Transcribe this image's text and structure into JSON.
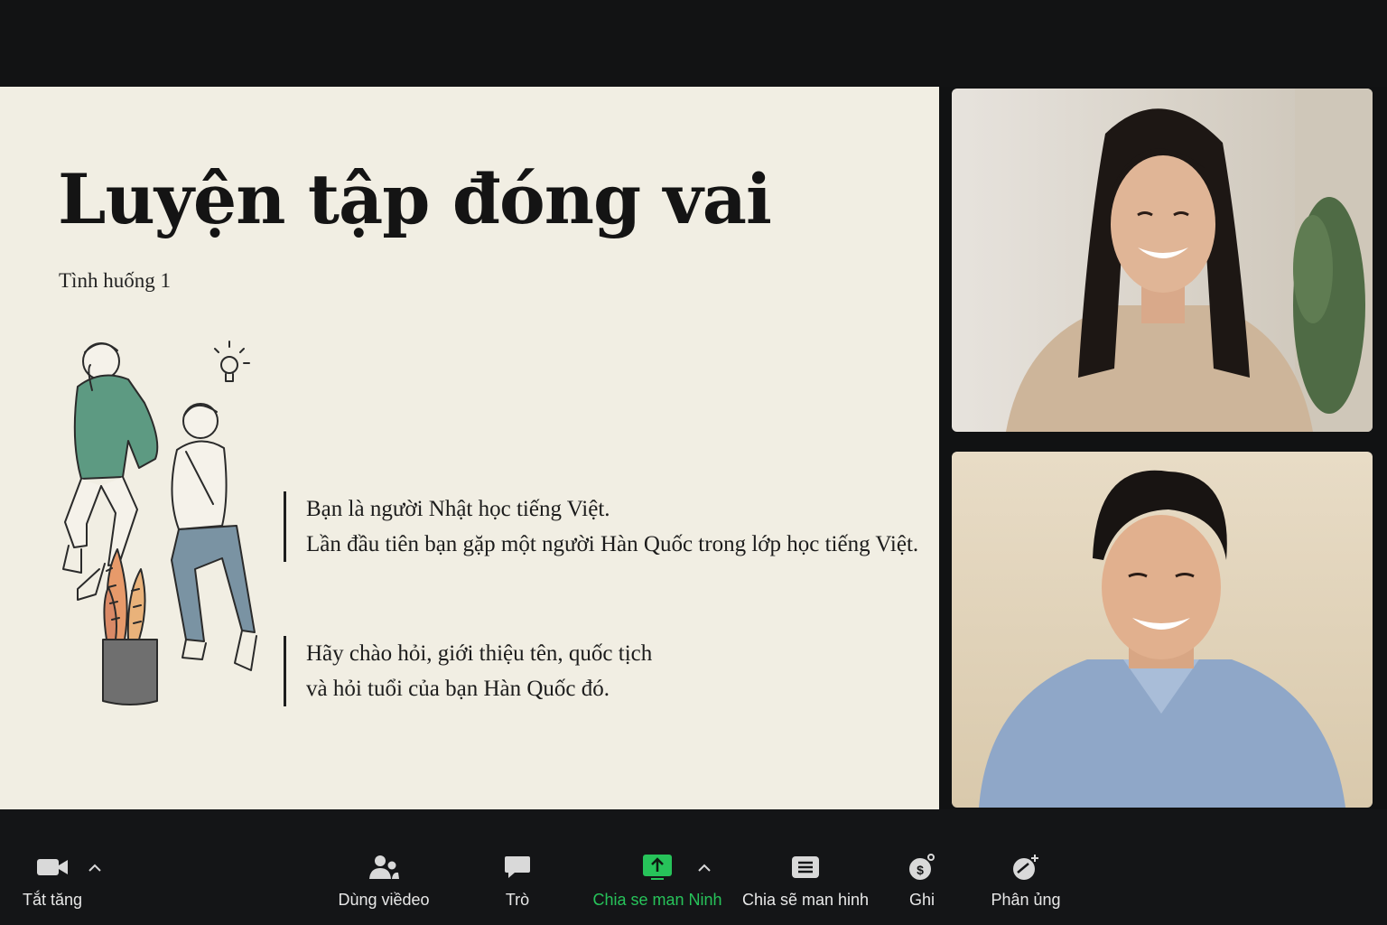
{
  "slide": {
    "title": "Luyện tập đóng vai",
    "subtitle": "Tình huống 1",
    "block1": [
      "Bạn là người Nhật học tiếng Việt.",
      "Lần đầu tiên bạn gặp một người Hàn Quốc trong lớp học tiếng Việt."
    ],
    "block2": [
      "Hãy chào hỏi, giới thiệu tên, quốc tịch",
      "và hỏi tuổi của bạn Hàn Quốc đó."
    ]
  },
  "toolbar": {
    "mute_label": "Tắt tăng",
    "video_label": "Dùng viềdeo",
    "chat_label": "Trò",
    "share_label": "Chia se man Ninh",
    "share2_label": "Chia sẽ man hinh",
    "record_label": "Ghi",
    "react_label": "Phân ủng",
    "active_color": "#27c35a"
  }
}
